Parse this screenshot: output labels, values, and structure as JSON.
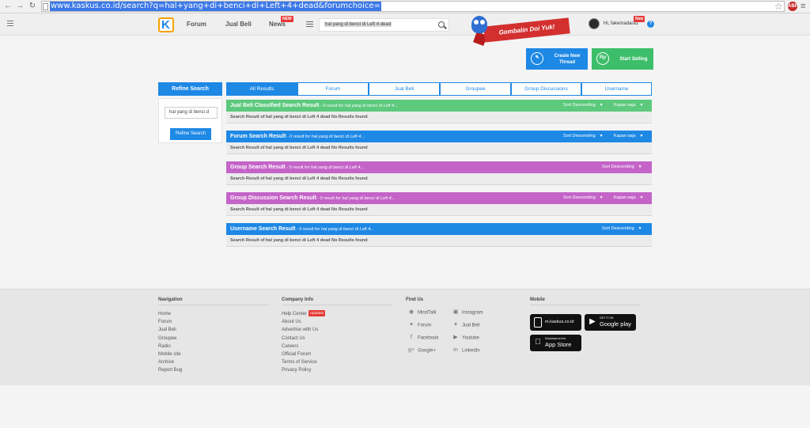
{
  "browser": {
    "url": "www.kaskus.co.id/search?q=hal+yang+di+benci+di+Left+4+dead&forumchoice="
  },
  "header": {
    "nav": [
      {
        "label": "Forum"
      },
      {
        "label": "Jual Beli"
      },
      {
        "label": "News",
        "badge": "NEW"
      }
    ],
    "search_value": "hal yang di benci di Left 4 dead",
    "promo_text": "Gombalin Doi Yuk!",
    "user_greeting": "Hi, fakemadara1",
    "user_badge": "New"
  },
  "actions": {
    "create_thread": "Create New Thread",
    "start_selling": "Start Selling"
  },
  "refine": {
    "title": "Refine Search",
    "input_value": "hal yang di benci d",
    "button": "Refine Search"
  },
  "tabs": [
    "All Results",
    "Forum",
    "Jual Beli",
    "Groupee",
    "Group Discussions",
    "Username"
  ],
  "results": [
    {
      "title": "Jual Beli Classified Search Result",
      "meta": " - 0 result for ",
      "query": "hal yang di benci di Left 4...",
      "sort": "Sort Descending",
      "filter": "Kapan saja",
      "body": "Search Result of hal yang di benci di Left 4 dead No Results found",
      "color": "#5cc97c"
    },
    {
      "title": "Forum Search Result",
      "meta": " - 0 result for ",
      "query": "hal yang di benci di Left 4...",
      "sort": "Sort Descending",
      "filter": "Kapan saja",
      "body": "Search Result of hal yang di benci di Left 4 dead No Results found",
      "color": "#1e88e5"
    },
    {
      "title": "Group Search Result",
      "meta": " - 0 result for ",
      "query": "hal yang di benci di Left 4...",
      "sort": "Sort Descending",
      "body": "Search Result of hal yang di benci di Left 4 dead No Results found",
      "color": "#c464c8"
    },
    {
      "title": "Group Discussion Search Result",
      "meta": " - 0 result for ",
      "query": "hal yang di benci di Left 4...",
      "sort": "Sort Descending",
      "filter": "Kapan saja",
      "body": "Search Result of hal yang di benci di Left 4 dead No Results found",
      "color": "#c464c8"
    },
    {
      "title": "Username Search Result",
      "meta": " - 0 result for ",
      "query": "hal yang di benci di Left 4...",
      "sort": "Sort Descending",
      "body": "Search Result of hal yang di benci di Left 4 dead No Results found",
      "color": "#1e88e5"
    }
  ],
  "footer": {
    "navigation_title": "Navigation",
    "navigation": [
      "Home",
      "Forum",
      "Jual Beli",
      "Groupee",
      "Radio",
      "Mobile site",
      "Archive",
      "Report Bug"
    ],
    "company_title": "Company Info",
    "company": [
      "Help Center",
      "About Us",
      "Advertise with Us",
      "Contact Us",
      "Careers",
      "Official Forum",
      "Terms of Service",
      "Privacy Policy"
    ],
    "company_badge": "Updated",
    "findus_title": "Find Us",
    "findus_left": [
      "MindTalk",
      "Forum",
      "Facebook",
      "Google+"
    ],
    "findus_right": [
      "Instagram",
      "Jual Beli",
      "Youtube",
      "LinkedIn"
    ],
    "mobile_title": "Mobile",
    "mobile_site": "m.kaskus.co.id",
    "gplay_small": "GET IT ON",
    "gplay_big": "Google play",
    "appstore_small": "Download on the",
    "appstore_big": "App Store"
  }
}
